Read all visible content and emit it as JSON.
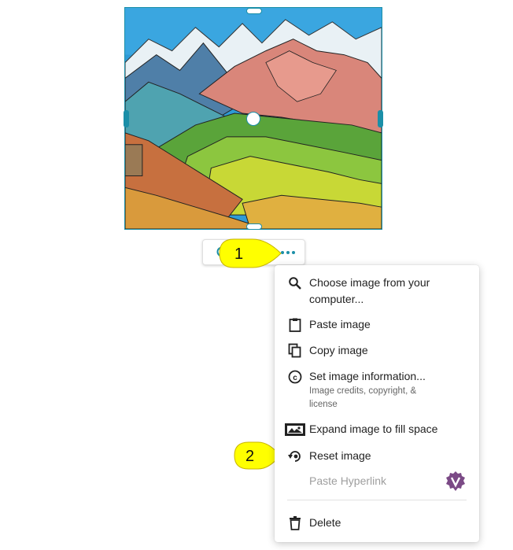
{
  "image": {
    "alt": "Mountain landscape illustration"
  },
  "toolbar": {
    "buttons": [
      {
        "icon": "magnifier-icon"
      },
      {
        "icon": "image-icon"
      },
      {
        "icon": "more-horizontal-icon"
      }
    ]
  },
  "callouts": [
    {
      "label": "1",
      "color": "#ffff00"
    },
    {
      "label": "2",
      "color": "#ffff00"
    }
  ],
  "menu": {
    "items": [
      {
        "label": "Choose image from your computer...",
        "icon": "search-icon"
      },
      {
        "label": "Paste image",
        "icon": "clipboard-icon"
      },
      {
        "label": "Copy image",
        "icon": "copy-icon"
      },
      {
        "label": "Set image information...",
        "sublabel": "Image credits, copyright, & license",
        "icon": "copyright-icon"
      },
      {
        "label": "Expand image to fill space",
        "icon": "expand-image-icon"
      },
      {
        "label": "Reset image",
        "icon": "reset-image-icon"
      },
      {
        "label": "Paste Hyperlink",
        "icon": "shield-badge-icon",
        "disabled": true
      },
      {
        "label": "Delete",
        "icon": "trash-icon"
      }
    ]
  },
  "colors": {
    "accent": "#1b8fa8",
    "callout": "#ffff00",
    "badge": "#7b4a86"
  }
}
